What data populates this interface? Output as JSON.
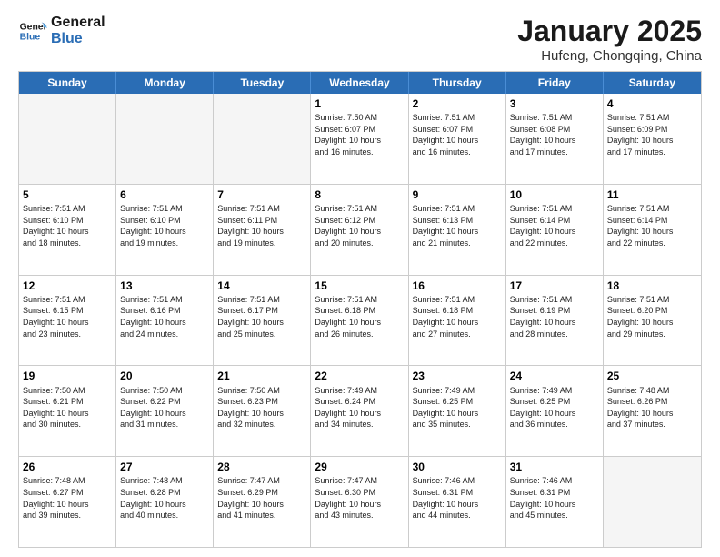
{
  "logo": {
    "line1": "General",
    "line2": "Blue"
  },
  "title": "January 2025",
  "location": "Hufeng, Chongqing, China",
  "days_of_week": [
    "Sunday",
    "Monday",
    "Tuesday",
    "Wednesday",
    "Thursday",
    "Friday",
    "Saturday"
  ],
  "weeks": [
    [
      {
        "day": "",
        "empty": true
      },
      {
        "day": "",
        "empty": true
      },
      {
        "day": "",
        "empty": true
      },
      {
        "day": "1",
        "lines": [
          "Sunrise: 7:50 AM",
          "Sunset: 6:07 PM",
          "Daylight: 10 hours",
          "and 16 minutes."
        ]
      },
      {
        "day": "2",
        "lines": [
          "Sunrise: 7:51 AM",
          "Sunset: 6:07 PM",
          "Daylight: 10 hours",
          "and 16 minutes."
        ]
      },
      {
        "day": "3",
        "lines": [
          "Sunrise: 7:51 AM",
          "Sunset: 6:08 PM",
          "Daylight: 10 hours",
          "and 17 minutes."
        ]
      },
      {
        "day": "4",
        "lines": [
          "Sunrise: 7:51 AM",
          "Sunset: 6:09 PM",
          "Daylight: 10 hours",
          "and 17 minutes."
        ]
      }
    ],
    [
      {
        "day": "5",
        "lines": [
          "Sunrise: 7:51 AM",
          "Sunset: 6:10 PM",
          "Daylight: 10 hours",
          "and 18 minutes."
        ]
      },
      {
        "day": "6",
        "lines": [
          "Sunrise: 7:51 AM",
          "Sunset: 6:10 PM",
          "Daylight: 10 hours",
          "and 19 minutes."
        ]
      },
      {
        "day": "7",
        "lines": [
          "Sunrise: 7:51 AM",
          "Sunset: 6:11 PM",
          "Daylight: 10 hours",
          "and 19 minutes."
        ]
      },
      {
        "day": "8",
        "lines": [
          "Sunrise: 7:51 AM",
          "Sunset: 6:12 PM",
          "Daylight: 10 hours",
          "and 20 minutes."
        ]
      },
      {
        "day": "9",
        "lines": [
          "Sunrise: 7:51 AM",
          "Sunset: 6:13 PM",
          "Daylight: 10 hours",
          "and 21 minutes."
        ]
      },
      {
        "day": "10",
        "lines": [
          "Sunrise: 7:51 AM",
          "Sunset: 6:14 PM",
          "Daylight: 10 hours",
          "and 22 minutes."
        ]
      },
      {
        "day": "11",
        "lines": [
          "Sunrise: 7:51 AM",
          "Sunset: 6:14 PM",
          "Daylight: 10 hours",
          "and 22 minutes."
        ]
      }
    ],
    [
      {
        "day": "12",
        "lines": [
          "Sunrise: 7:51 AM",
          "Sunset: 6:15 PM",
          "Daylight: 10 hours",
          "and 23 minutes."
        ]
      },
      {
        "day": "13",
        "lines": [
          "Sunrise: 7:51 AM",
          "Sunset: 6:16 PM",
          "Daylight: 10 hours",
          "and 24 minutes."
        ]
      },
      {
        "day": "14",
        "lines": [
          "Sunrise: 7:51 AM",
          "Sunset: 6:17 PM",
          "Daylight: 10 hours",
          "and 25 minutes."
        ]
      },
      {
        "day": "15",
        "lines": [
          "Sunrise: 7:51 AM",
          "Sunset: 6:18 PM",
          "Daylight: 10 hours",
          "and 26 minutes."
        ]
      },
      {
        "day": "16",
        "lines": [
          "Sunrise: 7:51 AM",
          "Sunset: 6:18 PM",
          "Daylight: 10 hours",
          "and 27 minutes."
        ]
      },
      {
        "day": "17",
        "lines": [
          "Sunrise: 7:51 AM",
          "Sunset: 6:19 PM",
          "Daylight: 10 hours",
          "and 28 minutes."
        ]
      },
      {
        "day": "18",
        "lines": [
          "Sunrise: 7:51 AM",
          "Sunset: 6:20 PM",
          "Daylight: 10 hours",
          "and 29 minutes."
        ]
      }
    ],
    [
      {
        "day": "19",
        "lines": [
          "Sunrise: 7:50 AM",
          "Sunset: 6:21 PM",
          "Daylight: 10 hours",
          "and 30 minutes."
        ]
      },
      {
        "day": "20",
        "lines": [
          "Sunrise: 7:50 AM",
          "Sunset: 6:22 PM",
          "Daylight: 10 hours",
          "and 31 minutes."
        ]
      },
      {
        "day": "21",
        "lines": [
          "Sunrise: 7:50 AM",
          "Sunset: 6:23 PM",
          "Daylight: 10 hours",
          "and 32 minutes."
        ]
      },
      {
        "day": "22",
        "lines": [
          "Sunrise: 7:49 AM",
          "Sunset: 6:24 PM",
          "Daylight: 10 hours",
          "and 34 minutes."
        ]
      },
      {
        "day": "23",
        "lines": [
          "Sunrise: 7:49 AM",
          "Sunset: 6:25 PM",
          "Daylight: 10 hours",
          "and 35 minutes."
        ]
      },
      {
        "day": "24",
        "lines": [
          "Sunrise: 7:49 AM",
          "Sunset: 6:25 PM",
          "Daylight: 10 hours",
          "and 36 minutes."
        ]
      },
      {
        "day": "25",
        "lines": [
          "Sunrise: 7:48 AM",
          "Sunset: 6:26 PM",
          "Daylight: 10 hours",
          "and 37 minutes."
        ]
      }
    ],
    [
      {
        "day": "26",
        "lines": [
          "Sunrise: 7:48 AM",
          "Sunset: 6:27 PM",
          "Daylight: 10 hours",
          "and 39 minutes."
        ]
      },
      {
        "day": "27",
        "lines": [
          "Sunrise: 7:48 AM",
          "Sunset: 6:28 PM",
          "Daylight: 10 hours",
          "and 40 minutes."
        ]
      },
      {
        "day": "28",
        "lines": [
          "Sunrise: 7:47 AM",
          "Sunset: 6:29 PM",
          "Daylight: 10 hours",
          "and 41 minutes."
        ]
      },
      {
        "day": "29",
        "lines": [
          "Sunrise: 7:47 AM",
          "Sunset: 6:30 PM",
          "Daylight: 10 hours",
          "and 43 minutes."
        ]
      },
      {
        "day": "30",
        "lines": [
          "Sunrise: 7:46 AM",
          "Sunset: 6:31 PM",
          "Daylight: 10 hours",
          "and 44 minutes."
        ]
      },
      {
        "day": "31",
        "lines": [
          "Sunrise: 7:46 AM",
          "Sunset: 6:31 PM",
          "Daylight: 10 hours",
          "and 45 minutes."
        ]
      },
      {
        "day": "",
        "empty": true
      }
    ]
  ]
}
